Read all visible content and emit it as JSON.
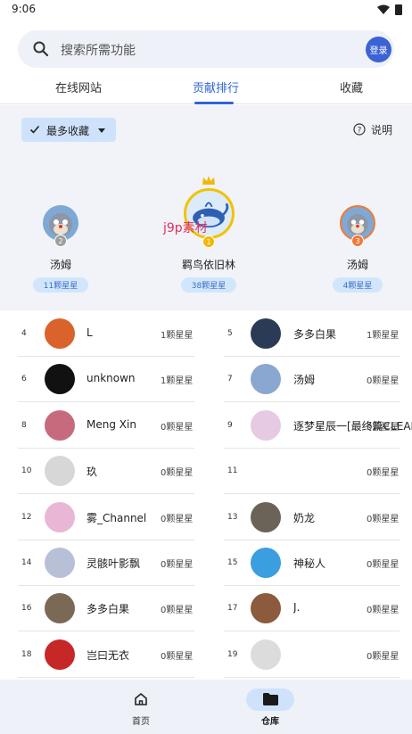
{
  "status_bar": {
    "time": "9:06"
  },
  "search": {
    "placeholder": "搜索所需功能",
    "login_label": "登录"
  },
  "tabs": [
    {
      "label": "在线网站",
      "active": false
    },
    {
      "label": "贡献排行",
      "active": true
    },
    {
      "label": "收藏",
      "active": false
    }
  ],
  "filter": {
    "label": "最多收藏",
    "explain_label": "说明"
  },
  "podium": [
    {
      "rank": "2",
      "name": "汤姆",
      "stars": "11颗星星",
      "badge_color": "#9e9e9e"
    },
    {
      "rank": "1",
      "name": "羁鸟依旧林",
      "stars": "38颗星星",
      "badge_color": "#f2b705"
    },
    {
      "rank": "3",
      "name": "汤姆",
      "stars": "4颗星星",
      "badge_color": "#f07a3a"
    }
  ],
  "watermark": "j9p素材",
  "ranking": [
    {
      "rank": "4",
      "name": "L",
      "stars": "1颗星星"
    },
    {
      "rank": "5",
      "name": "多多白果",
      "stars": "1颗星星"
    },
    {
      "rank": "6",
      "name": "unknown",
      "stars": "1颗星星"
    },
    {
      "rank": "7",
      "name": "汤姆",
      "stars": "0颗星星"
    },
    {
      "rank": "8",
      "name": "Meng Xin",
      "stars": "0颗星星"
    },
    {
      "rank": "9",
      "name": "逐梦星辰一[最终篇CLEAR",
      "stars": "0颗星星"
    },
    {
      "rank": "10",
      "name": "玖",
      "stars": "0颗星星"
    },
    {
      "rank": "11",
      "name": "",
      "stars": "0颗星星"
    },
    {
      "rank": "12",
      "name": "雾_Channel",
      "stars": "0颗星星"
    },
    {
      "rank": "13",
      "name": "奶龙",
      "stars": "0颗星星"
    },
    {
      "rank": "14",
      "name": "灵骸叶影飘",
      "stars": "0颗星星"
    },
    {
      "rank": "15",
      "name": "神秘人",
      "stars": "0颗星星"
    },
    {
      "rank": "16",
      "name": "多多白果",
      "stars": "0颗星星"
    },
    {
      "rank": "17",
      "name": "J.",
      "stars": "0颗星星"
    },
    {
      "rank": "18",
      "name": "岂曰无衣",
      "stars": "0颗星星"
    },
    {
      "rank": "19",
      "name": "",
      "stars": "0颗星星"
    }
  ],
  "bottom_nav": [
    {
      "label": "首页",
      "icon": "home-icon",
      "active": false
    },
    {
      "label": "仓库",
      "icon": "folder-icon",
      "active": true
    }
  ],
  "colors": {
    "accent": "#2f63d8",
    "pill_bg": "#d2e6fb",
    "panel_bg": "#f1f3f8"
  }
}
